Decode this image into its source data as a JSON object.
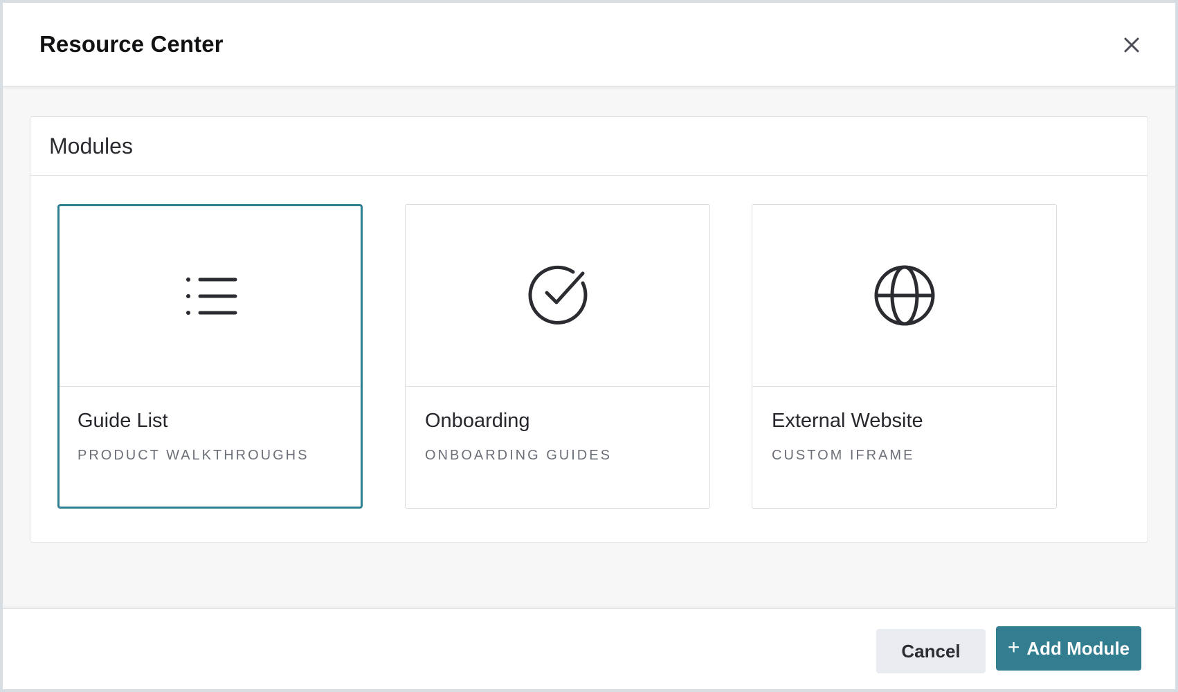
{
  "dialog": {
    "title": "Resource Center",
    "close_icon": "close-icon"
  },
  "modules": {
    "heading": "Modules",
    "cards": [
      {
        "name": "Guide List",
        "subtitle": "PRODUCT WALKTHROUGHS",
        "icon": "list-icon",
        "selected": true
      },
      {
        "name": "Onboarding",
        "subtitle": "ONBOARDING GUIDES",
        "icon": "check-circle-icon",
        "selected": false
      },
      {
        "name": "External Website",
        "subtitle": "CUSTOM IFRAME",
        "icon": "globe-icon",
        "selected": false
      }
    ]
  },
  "footer": {
    "cancel_label": "Cancel",
    "add_label": "Add Module",
    "add_icon": "plus-icon"
  },
  "colors": {
    "accent": "#327d90",
    "selected_border": "#2f7f92",
    "cancel_bg": "#e8ebef"
  }
}
